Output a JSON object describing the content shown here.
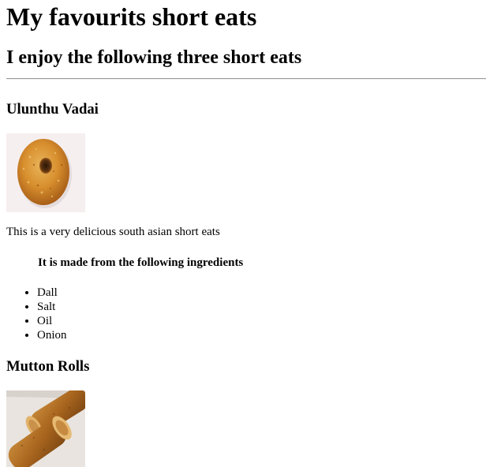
{
  "page": {
    "title": "My favourits short eats",
    "subtitle": "I enjoy the following three short eats"
  },
  "items": [
    {
      "name": "Ulunthu Vadai",
      "description": "This is a very delicious south asian short eats",
      "ingredients_heading": "It is made from the following ingredients",
      "ingredients": [
        "Dall",
        "Salt",
        "Oil",
        "Onion"
      ]
    },
    {
      "name": "Mutton Rolls"
    }
  ]
}
